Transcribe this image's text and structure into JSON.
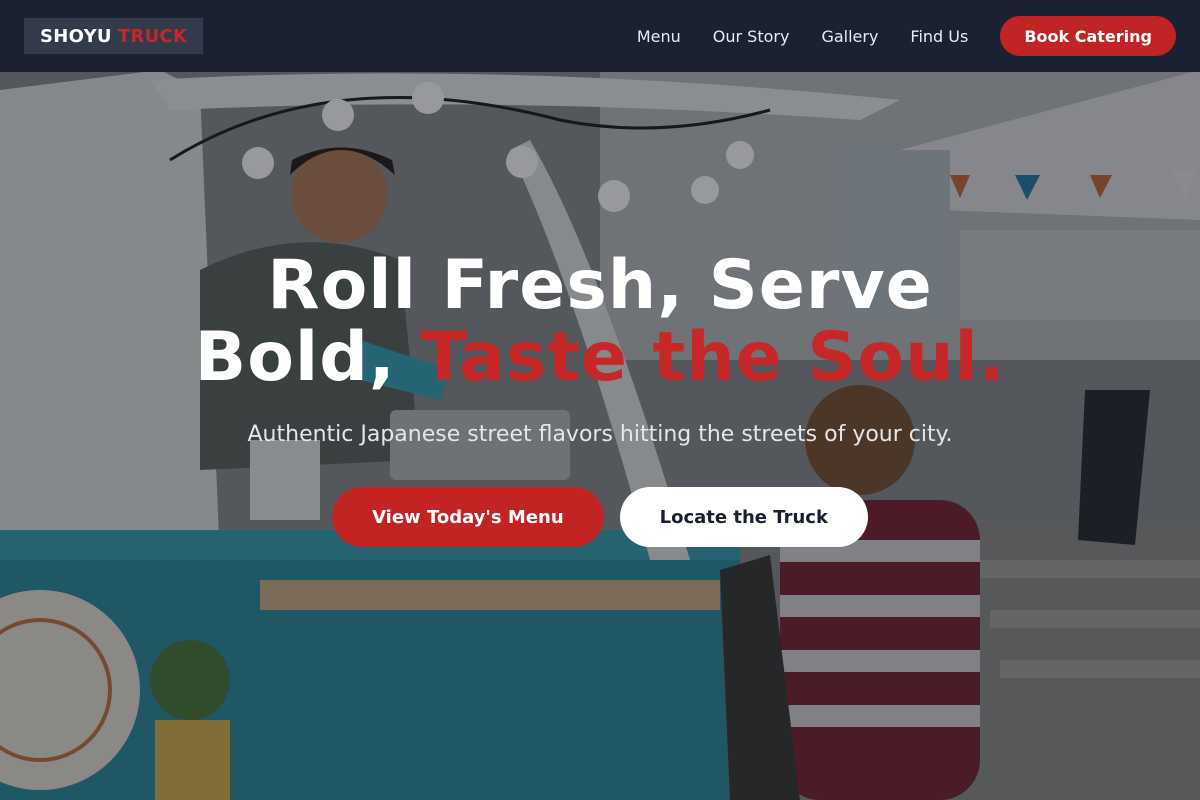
{
  "brand": {
    "word1": "SHOYU",
    "word2": "TRUCK"
  },
  "nav": {
    "links": [
      "Menu",
      "Our Story",
      "Gallery",
      "Find Us"
    ],
    "cta_label": "Book Catering"
  },
  "hero": {
    "headline_line1": "Roll Fresh, Serve",
    "headline_line2_plain": "Bold, ",
    "headline_line2_accent": "Taste the Soul.",
    "subtitle": "Authentic Japanese street flavors hitting the streets of your city.",
    "primary_button": "View Today's Menu",
    "secondary_button": "Locate the Truck"
  },
  "colors": {
    "nav_bg": "#1c2132",
    "accent_red": "#c62828",
    "button_red": "#c22323",
    "white": "#ffffff"
  }
}
